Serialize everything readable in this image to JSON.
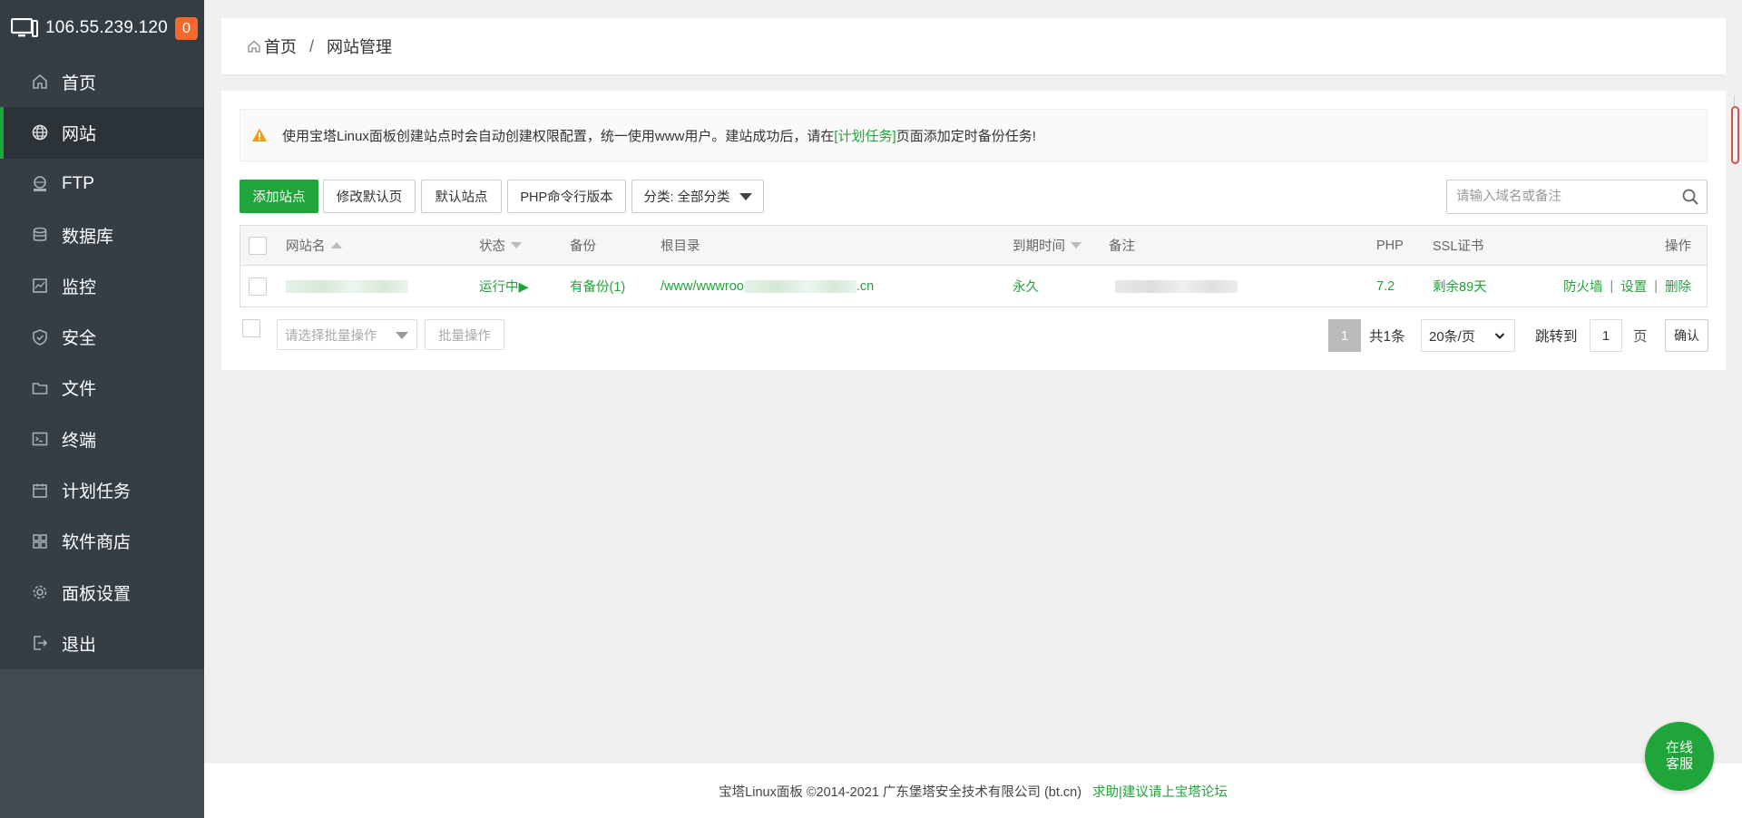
{
  "header": {
    "ip": "106.55.239.120",
    "badge": "0"
  },
  "sidebar": {
    "items": [
      {
        "label": "首页",
        "icon": "home-icon"
      },
      {
        "label": "网站",
        "icon": "globe-icon",
        "active": true
      },
      {
        "label": "FTP",
        "icon": "ftp-icon"
      },
      {
        "label": "数据库",
        "icon": "database-icon"
      },
      {
        "label": "监控",
        "icon": "monitor-chart-icon"
      },
      {
        "label": "安全",
        "icon": "shield-icon"
      },
      {
        "label": "文件",
        "icon": "folder-icon"
      },
      {
        "label": "终端",
        "icon": "terminal-icon"
      },
      {
        "label": "计划任务",
        "icon": "calendar-icon"
      },
      {
        "label": "软件商店",
        "icon": "grid-icon"
      },
      {
        "label": "面板设置",
        "icon": "gear-icon"
      },
      {
        "label": "退出",
        "icon": "logout-icon"
      }
    ]
  },
  "breadcrumb": {
    "home": "首页",
    "separator": "/",
    "current": "网站管理"
  },
  "notice": {
    "text_before": "使用宝塔Linux面板创建站点时会自动创建权限配置，统一使用www用户。建站成功后，请在",
    "link": "[计划任务]",
    "text_after": "页面添加定时备份任务!"
  },
  "toolbar": {
    "add_site": "添加站点",
    "edit_default_page": "修改默认页",
    "default_site": "默认站点",
    "php_cli_version": "PHP命令行版本",
    "category": "分类: 全部分类"
  },
  "search": {
    "placeholder": "请输入域名或备注"
  },
  "table": {
    "headers": {
      "name": "网站名",
      "status": "状态",
      "backup": "备份",
      "root": "根目录",
      "expire": "到期时间",
      "remark": "备注",
      "php": "PHP",
      "ssl": "SSL证书",
      "actions": "操作"
    },
    "rows": [
      {
        "status": "运行中▶",
        "backup": "有备份(1)",
        "root_prefix": "/www/wwwroo",
        "root_suffix": ".cn",
        "expire": "永久",
        "php": "7.2",
        "ssl": "剩余89天",
        "action_firewall": "防火墙",
        "action_settings": "设置",
        "action_delete": "删除",
        "action_sep": "|"
      }
    ]
  },
  "batch": {
    "select_placeholder": "请选择批量操作",
    "button": "批量操作"
  },
  "pagination": {
    "current": "1",
    "total": "共1条",
    "page_size": "20条/页",
    "jump_label": "跳转到",
    "jump_value": "1",
    "unit": "页",
    "confirm": "确认"
  },
  "footer": {
    "copyright": "宝塔Linux面板 ©2014-2021 广东堡塔安全技术有限公司 (bt.cn)",
    "link": "求助|建议请上宝塔论坛"
  },
  "chat": {
    "line1": "在线",
    "line2": "客服"
  },
  "colors": {
    "accent": "#20a53a",
    "sidebar": "#363e45",
    "badge": "#f7692a"
  }
}
